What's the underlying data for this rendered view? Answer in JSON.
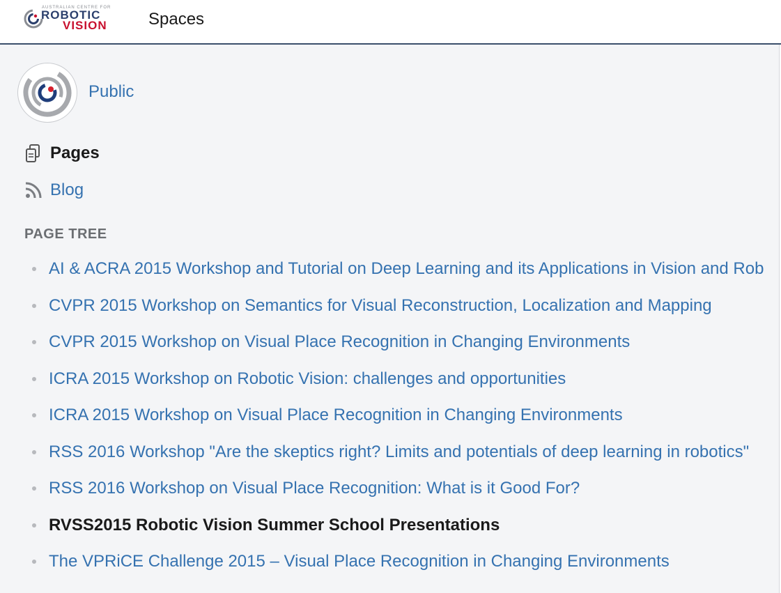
{
  "header": {
    "logo": {
      "tagline": "AUSTRALIAN CENTRE FOR",
      "line1": "ROBOTIC",
      "line2": "VISION"
    },
    "spaces_label": "Spaces"
  },
  "sidebar": {
    "space_name": "Public",
    "nav": [
      {
        "label": "Pages",
        "icon": "pages-icon",
        "active": true
      },
      {
        "label": "Blog",
        "icon": "rss-icon",
        "active": false
      }
    ],
    "page_tree_heading": "PAGE TREE",
    "page_tree": [
      {
        "label": "AI & ACRA 2015 Workshop and Tutorial on Deep Learning and its Applications in Vision and Rob"
      },
      {
        "label": "CVPR 2015 Workshop on Semantics for Visual Reconstruction, Localization and Mapping"
      },
      {
        "label": "CVPR 2015 Workshop on Visual Place Recognition in Changing Environments"
      },
      {
        "label": "ICRA 2015 Workshop on Robotic Vision: challenges and opportunities"
      },
      {
        "label": "ICRA 2015 Workshop on Visual Place Recognition in Changing Environments"
      },
      {
        "label": "RSS 2016 Workshop \"Are the skeptics right? Limits and potentials of deep learning in robotics\""
      },
      {
        "label": "RSS 2016 Workshop on Visual Place Recognition: What is it Good For?"
      },
      {
        "label": "RVSS2015 Robotic Vision Summer School Presentations",
        "current": true
      },
      {
        "label": "The VPRiCE Challenge 2015 – Visual Place Recognition in Changing Environments"
      }
    ]
  },
  "colors": {
    "link": "#3572b0",
    "brand_navy": "#2b3f6c",
    "brand_red": "#c8102e",
    "sidebar_bg": "#f4f5f7"
  }
}
